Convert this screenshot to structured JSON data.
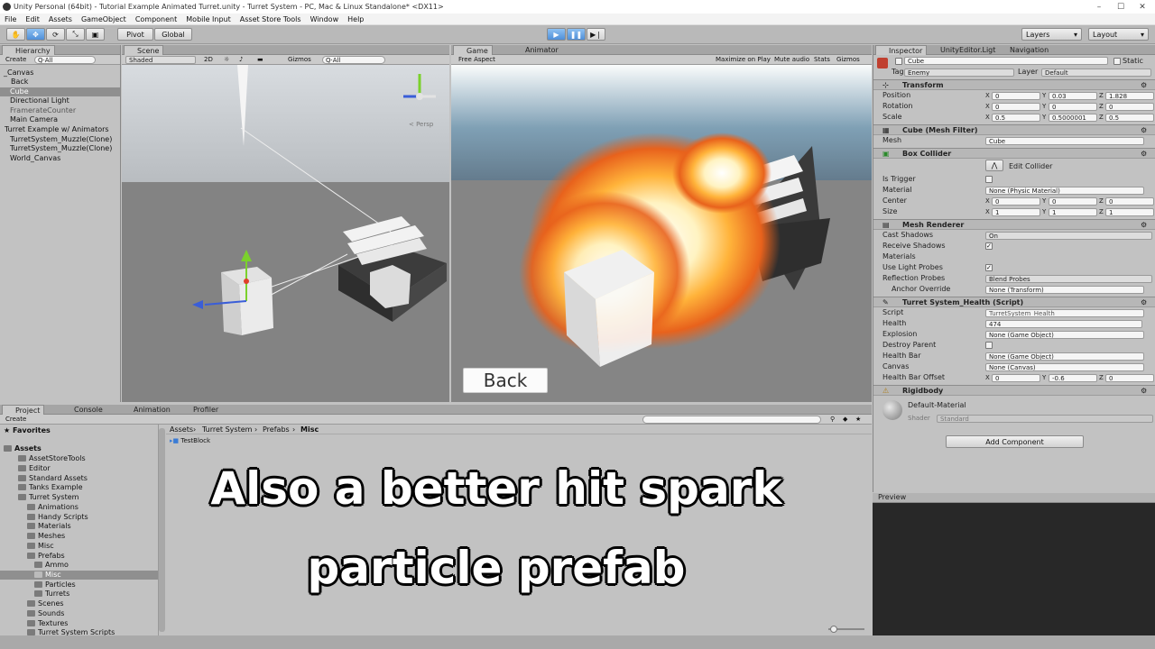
{
  "window": {
    "title": "Unity Personal (64bit) - Tutorial Example Animated Turret.unity - Turret System - PC, Mac & Linux Standalone* <DX11>"
  },
  "menu": [
    "File",
    "Edit",
    "Assets",
    "GameObject",
    "Component",
    "Mobile Input",
    "Asset Store Tools",
    "Window",
    "Help"
  ],
  "toolbar": {
    "pivot": "Pivot",
    "global": "Global",
    "layers": "Layers",
    "layout": "Layout"
  },
  "hierarchy": {
    "tab": "Hierarchy",
    "create": "Create",
    "search": "Q·All",
    "items": [
      "_Canvas",
      "Back",
      "Cube",
      "Directional Light",
      "FramerateCounter",
      "Main Camera",
      "Turret Example w/ Animators",
      "TurretSystem_Muzzle(Clone)",
      "TurretSystem_Muzzle(Clone)",
      "World_Canvas"
    ]
  },
  "scene": {
    "tab": "Scene",
    "shading": "Shaded",
    "mode2d": "2D",
    "gizmos": "Gizmos",
    "search": "Q·All",
    "persp": "< Persp"
  },
  "game": {
    "tab": "Game",
    "tab2": "Animator",
    "aspect": "Free Aspect",
    "maximize": "Maximize on Play",
    "mute": "Mute audio",
    "stats": "Stats",
    "gizmos": "Gizmos",
    "back_button": "Back"
  },
  "inspector": {
    "tab": "Inspector",
    "tab2": "UnityEditor.Ligt",
    "tab3": "Navigation",
    "object_name": "Cube",
    "static_label": "Static",
    "tag_label": "Tag",
    "tag_value": "Enemy",
    "layer_label": "Layer",
    "layer_value": "Default",
    "transform": {
      "title": "Transform",
      "position": [
        "0",
        "0.03",
        "1.828"
      ],
      "rotation": [
        "0",
        "0",
        "0"
      ],
      "scale": [
        "0.5",
        "0.5000001",
        "0.5"
      ],
      "position_label": "Position",
      "rotation_label": "Rotation",
      "scale_label": "Scale"
    },
    "mesh_filter": {
      "title": "Cube (Mesh Filter)",
      "mesh_label": "Mesh",
      "mesh_value": "Cube"
    },
    "box_collider": {
      "title": "Box Collider",
      "edit": "Edit Collider",
      "is_trigger": "Is Trigger",
      "material_label": "Material",
      "material_value": "None (Physic Material)",
      "center_label": "Center",
      "center": [
        "0",
        "0",
        "0"
      ],
      "size_label": "Size",
      "size": [
        "1",
        "1",
        "1"
      ]
    },
    "mesh_renderer": {
      "title": "Mesh Renderer",
      "cast_shadows": "Cast Shadows",
      "cast_shadows_value": "On",
      "receive_shadows": "Receive Shadows",
      "materials": "Materials",
      "light_probes": "Use Light Probes",
      "reflection_probes": "Reflection Probes",
      "reflection_value": "Blend Probes",
      "anchor": "Anchor Override",
      "anchor_value": "None (Transform)"
    },
    "health": {
      "title": "Turret System_Health (Script)",
      "script_label": "Script",
      "script_value": "TurretSystem_Health",
      "health_label": "Health",
      "health_value": "474",
      "explosion_label": "Explosion",
      "explosion_value": "None (Game Object)",
      "destroy_parent": "Destroy Parent",
      "health_bar_label": "Health Bar",
      "health_bar_value": "None (Game Object)",
      "canvas_label": "Canvas",
      "canvas_value": "None (Canvas)",
      "offset_label": "Health Bar Offset",
      "offset": [
        "0",
        "-0.6",
        "0"
      ]
    },
    "rigidbody": {
      "title": "Rigidbody"
    },
    "material": {
      "name": "Default-Material",
      "shader_label": "Shader",
      "shader_value": "Standard"
    },
    "add_component": "Add Component",
    "preview": "Preview"
  },
  "project": {
    "tabs": [
      "Project",
      "Console",
      "Animation",
      "Profiler"
    ],
    "create": "Create",
    "favorites": "Favorites",
    "tree": [
      "Assets",
      "AssetStoreTools",
      "Editor",
      "Standard Assets",
      "Tanks Example",
      "Turret System",
      "Animations",
      "Handy Scripts",
      "Materials",
      "Meshes",
      "Misc",
      "Prefabs",
      "Ammo",
      "Misc",
      "Particles",
      "Turrets",
      "Scenes",
      "Sounds",
      "Textures",
      "Turret System Scripts"
    ],
    "breadcrumb": [
      "Assets",
      "Turret System",
      "Prefabs",
      "Misc"
    ],
    "files": [
      "TestBlock"
    ]
  },
  "caption": {
    "line1": "Also a better hit spark",
    "line2": "particle prefab"
  },
  "colors": {
    "accent": "#4f8fd8",
    "panel": "#c2c2c2",
    "selection": "#8f8f8f"
  }
}
